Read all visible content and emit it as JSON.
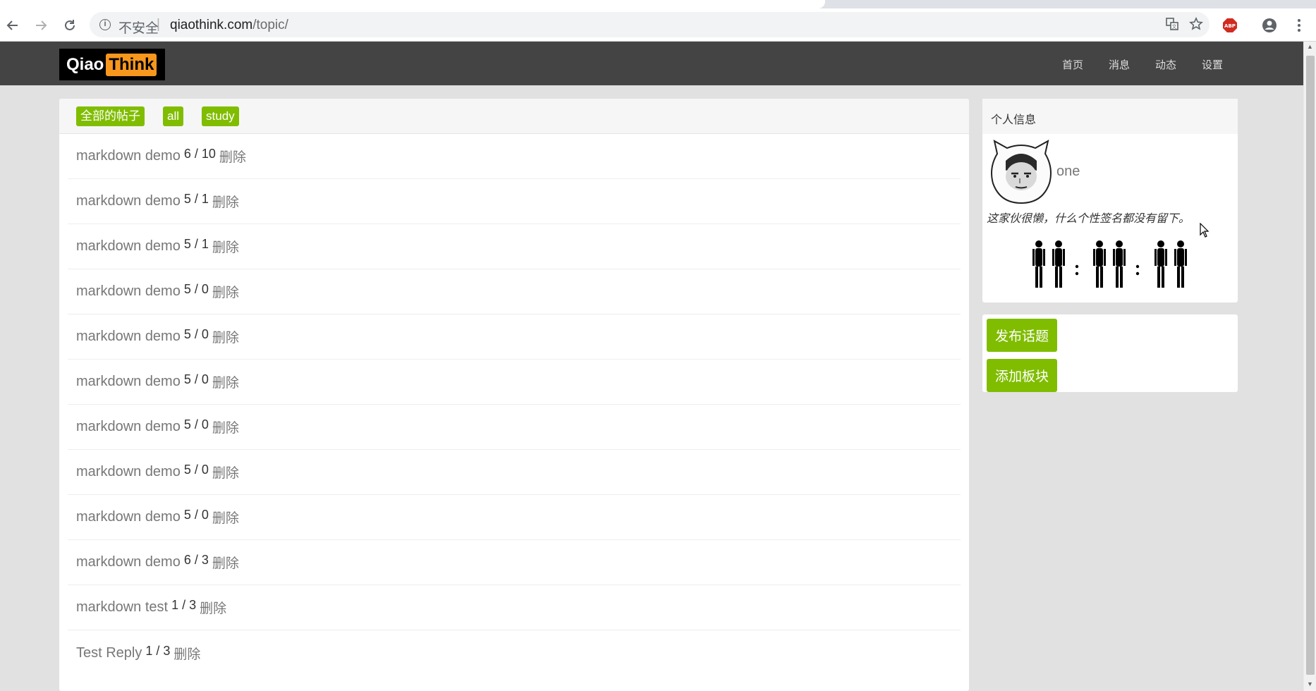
{
  "browser": {
    "security_label": "不安全",
    "separator": "|",
    "url_host": "qiaothink.com",
    "url_path": "/topic/",
    "extension_badge": "ABP"
  },
  "site": {
    "logo_part1": "Qiao",
    "logo_part2": "Think",
    "nav": [
      "首页",
      "消息",
      "动态",
      "设置"
    ]
  },
  "main": {
    "tags": [
      "全部的帖子",
      "all",
      "study"
    ],
    "topics": [
      {
        "title": "markdown demo",
        "count": "6 / 10",
        "action": "删除"
      },
      {
        "title": "markdown demo",
        "count": "5 / 1",
        "action": "删除"
      },
      {
        "title": "markdown demo",
        "count": "5 / 1",
        "action": "删除"
      },
      {
        "title": "markdown demo",
        "count": "5 / 0",
        "action": "删除"
      },
      {
        "title": "markdown demo",
        "count": "5 / 0",
        "action": "删除"
      },
      {
        "title": "markdown demo",
        "count": "5 / 0",
        "action": "删除"
      },
      {
        "title": "markdown demo",
        "count": "5 / 0",
        "action": "删除"
      },
      {
        "title": "markdown demo",
        "count": "5 / 0",
        "action": "删除"
      },
      {
        "title": "markdown demo",
        "count": "5 / 0",
        "action": "删除"
      },
      {
        "title": "markdown demo",
        "count": "6 / 3",
        "action": "删除"
      },
      {
        "title": "markdown test",
        "count": "1 / 3",
        "action": "删除"
      },
      {
        "title": "Test Reply",
        "count": "1 / 3",
        "action": "删除"
      }
    ]
  },
  "sidebar": {
    "profile_title": "个人信息",
    "username": "one",
    "signature": "这家伙很懒，什么个性签名都没有留下。",
    "buttons": [
      "发布话题",
      "添加板块"
    ]
  },
  "colors": {
    "accent_green": "#80bd01",
    "navbar_bg": "#444444",
    "logo_orange": "#f7971d"
  }
}
